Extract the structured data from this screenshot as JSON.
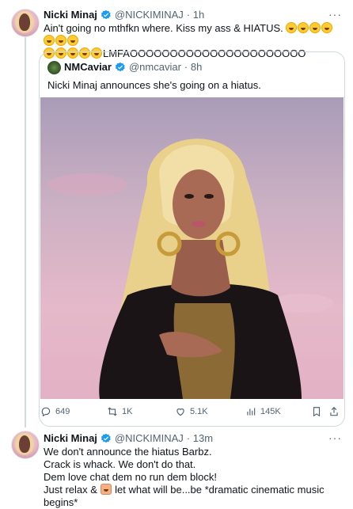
{
  "tweet1": {
    "name": "Nicki Minaj",
    "handle": "@NICKIMINAJ",
    "time": "· 1h",
    "line1": "Ain't going no mthfkn where. Kiss my ass & HIATUS.",
    "line2_suffix": "LMFAOOOOOOOOOOOOOOOOOOOOOO",
    "more": "···"
  },
  "quote": {
    "name": "NMCaviar",
    "handle": "@nmcaviar",
    "time": "· 8h",
    "text": "Nicki Minaj announces she's going on a hiatus."
  },
  "actions": {
    "reply": "649",
    "retweet": "1K",
    "like": "5.1K",
    "views": "145K"
  },
  "tweet2": {
    "name": "Nicki Minaj",
    "handle": "@NICKIMINAJ",
    "time": "· 13m",
    "lines": [
      "We don't announce the hiatus Barbz.",
      "Crack is whack. We don't do that.",
      "Dem love chat dem no run dem block!"
    ],
    "line4_start": "Just relax &",
    "line4_end": "let what will be...be *dramatic cinematic music begins*",
    "more": "···"
  },
  "colors": {
    "verified": "#1d9bf0",
    "secondary_text": "#536471",
    "border": "#cfd9de"
  }
}
